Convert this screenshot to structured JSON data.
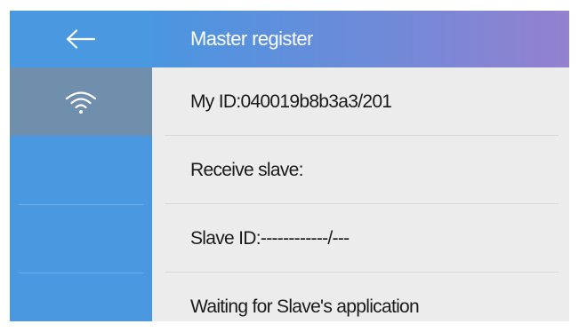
{
  "header": {
    "title": "Master register",
    "back_icon": "arrow-left-icon"
  },
  "sidebar": {
    "active_tab_icon": "wifi-icon"
  },
  "rows": [
    {
      "label": "My ID:040019b8b3a3/201"
    },
    {
      "label": "Receive slave:"
    },
    {
      "label": "Slave ID:------------/---"
    },
    {
      "label": "Waiting for Slave's application"
    }
  ],
  "colors": {
    "sidebar": "#4a98e0",
    "sidebar_active": "#6f8fad",
    "header_gradient_start": "#4a96e0",
    "header_gradient_end": "#9481cf",
    "content_bg": "#ececec",
    "text": "#1a1a1a"
  }
}
